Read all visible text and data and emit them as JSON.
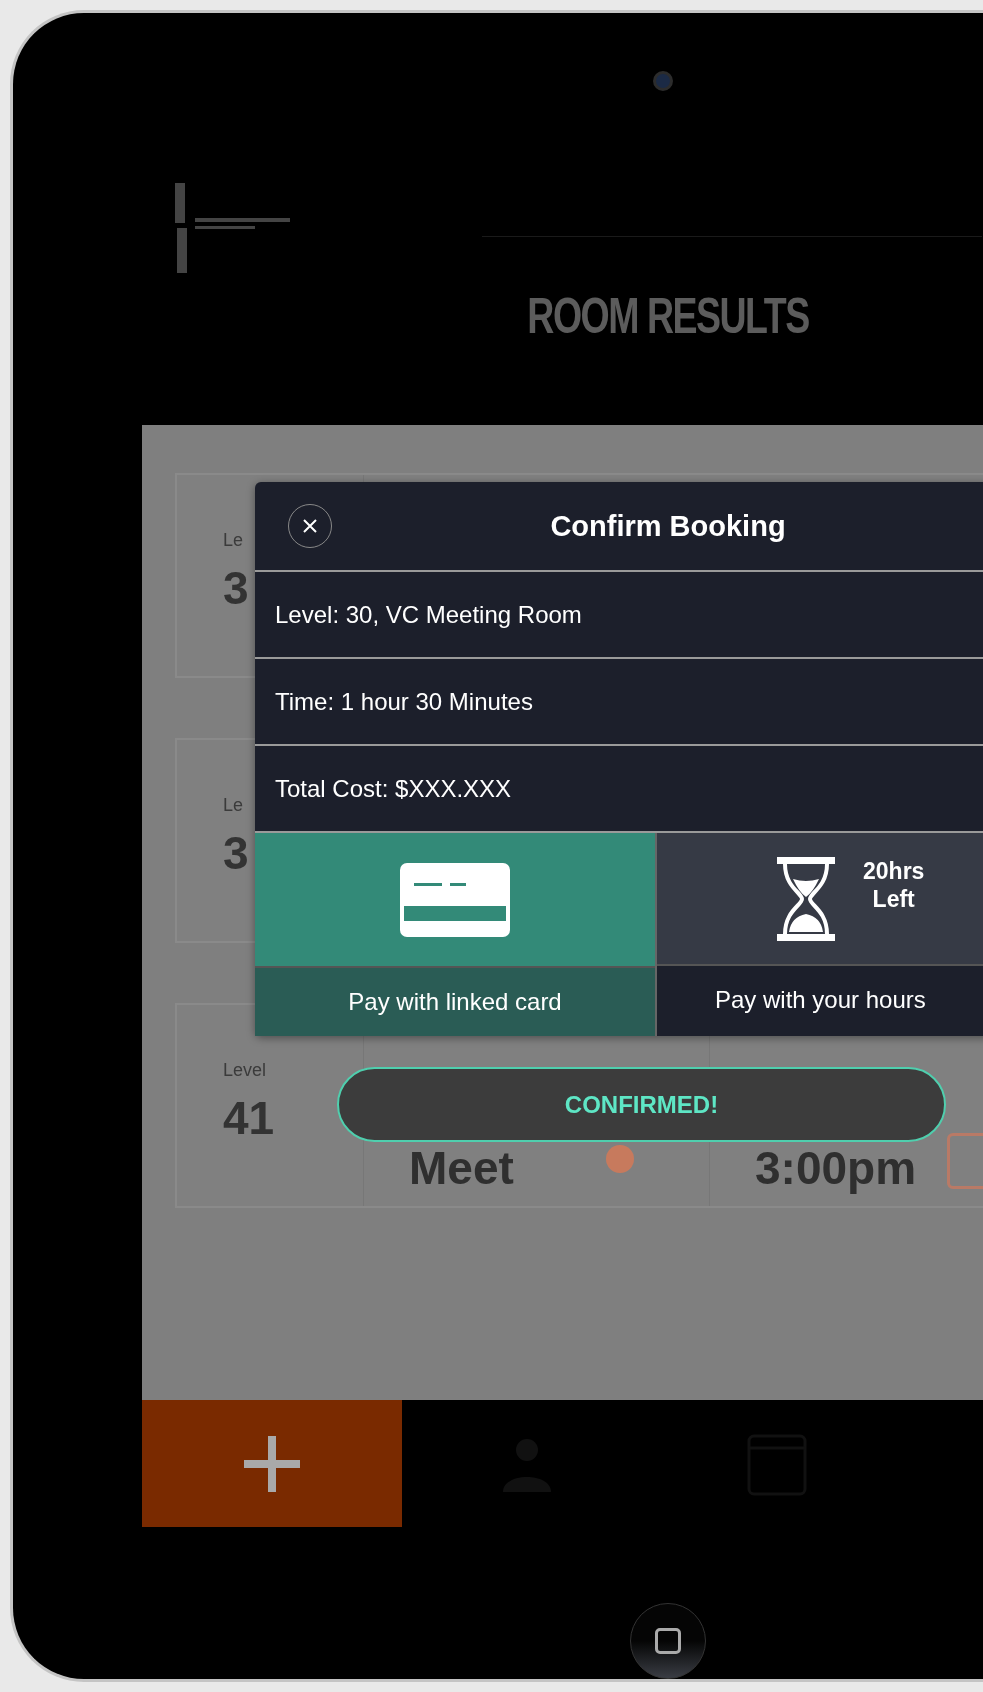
{
  "header": {
    "title": "ROOM RESULTS"
  },
  "cards": [
    {
      "label": "Le",
      "level": "3"
    },
    {
      "label": "Le",
      "level": "3"
    },
    {
      "label": "Level",
      "level": "41",
      "room": "Meet",
      "time": "3:00pm"
    }
  ],
  "modal": {
    "title": "Confirm Booking",
    "details": [
      "Level: 30, VC Meeting Room",
      "Time: 1 hour 30 Minutes",
      "Total Cost: $XXX.XXX"
    ],
    "options": [
      {
        "kind": "card",
        "label": "Pay with linked card",
        "selected": true
      },
      {
        "kind": "hours",
        "label": "Pay with your hours",
        "badge": [
          "20hrs",
          "Left"
        ],
        "selected": false
      }
    ]
  },
  "toast": "CONFIRMED!",
  "tabs": [
    {
      "kind": "add",
      "selected": true
    },
    {
      "kind": "person",
      "selected": false
    },
    {
      "kind": "calendar",
      "selected": false
    }
  ]
}
